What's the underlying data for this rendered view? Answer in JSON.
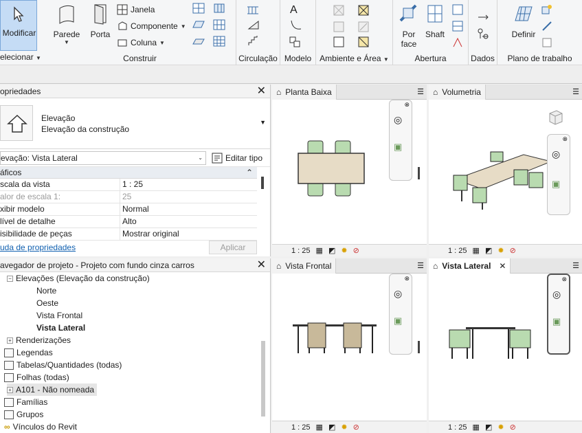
{
  "ribbon": {
    "modificar": "Modificar",
    "selecionar": "elecionar",
    "construir": {
      "label": "Construir",
      "parede": "Parede",
      "porta": "Porta",
      "janela": "Janela",
      "componente": "Componente",
      "coluna": "Coluna"
    },
    "circulacao": "Circulação",
    "modelo": "Modelo",
    "ambiente": "Ambiente e Área",
    "abertura": {
      "label": "Abertura",
      "porface": "Por",
      "porface2": "face",
      "shaft": "Shaft"
    },
    "dados": "Dados",
    "plano": {
      "label": "Plano de trabalho",
      "definir": "Definir"
    }
  },
  "properties": {
    "title": "opriedades",
    "type_line1": "Elevação",
    "type_line2": "Elevação da construção",
    "instance": "evação: Vista Lateral",
    "edit_type": "Editar tipo",
    "group": "áficos",
    "rows": [
      {
        "k": "scala da vista",
        "v": "1 : 25"
      },
      {
        "k": "alor de escala   1:",
        "v": "25"
      },
      {
        "k": "xibir modelo",
        "v": "Normal"
      },
      {
        "k": "lível de detalhe",
        "v": "Alto"
      },
      {
        "k": "isibilidade de peças",
        "v": "Mostrar original"
      }
    ],
    "help": "uda de propriedades",
    "apply": "Aplicar"
  },
  "browser": {
    "title": "avegador de projeto - Projeto com fundo cinza carros",
    "items": [
      "Elevações (Elevação da construção)",
      "Norte",
      "Oeste",
      "Vista Frontal",
      "Vista Lateral",
      "Renderizações",
      "Legendas",
      "Tabelas/Quantidades (todas)",
      "Folhas (todas)",
      "A101 - Não nomeada",
      "Famílias",
      "Grupos",
      "Vínculos do Revit"
    ]
  },
  "views": {
    "planta": {
      "title": "Planta Baixa",
      "scale": "1 : 25"
    },
    "volumetria": {
      "title": "Volumetria",
      "scale": "1 : 25"
    },
    "frontal": {
      "title": "Vista Frontal",
      "scale": "1 : 25"
    },
    "lateral": {
      "title": "Vista Lateral",
      "scale": "1 : 25"
    }
  },
  "colors": {
    "accent": "#c5dcf5",
    "furniture": "#e7dcc6",
    "seat": "#b9dbb0"
  }
}
